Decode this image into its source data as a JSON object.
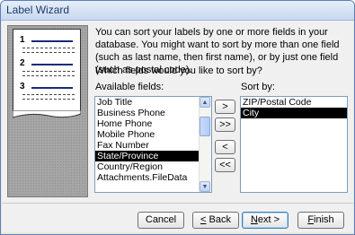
{
  "window": {
    "title": "Label Wizard"
  },
  "illustration": {
    "numbers": [
      "1",
      "2",
      "3"
    ]
  },
  "description": "You can sort your labels by one or more fields in your database.  You might want to sort by more than one field (such as last name, then first name), or by just one field (such as postal code).",
  "question": "Which fields would you like to sort by?",
  "available": {
    "label": "Available fields:",
    "items": [
      "Job Title",
      "Business Phone",
      "Home Phone",
      "Mobile Phone",
      "Fax Number",
      "State/Province",
      "Country/Region",
      "Attachments.FileData"
    ],
    "selected": "State/Province"
  },
  "sortby": {
    "label": "Sort by:",
    "items": [
      "ZIP/Postal Code",
      "City"
    ],
    "selected": "City"
  },
  "move_buttons": {
    "add_one": ">",
    "add_all": ">>",
    "remove_one": "<",
    "remove_all": "<<"
  },
  "footer": {
    "cancel": "Cancel",
    "back_mn": "<",
    "back_rest": " Back",
    "next_mn": "N",
    "next_rest": "ext >",
    "finish_mn": "F",
    "finish_rest": "inish"
  }
}
